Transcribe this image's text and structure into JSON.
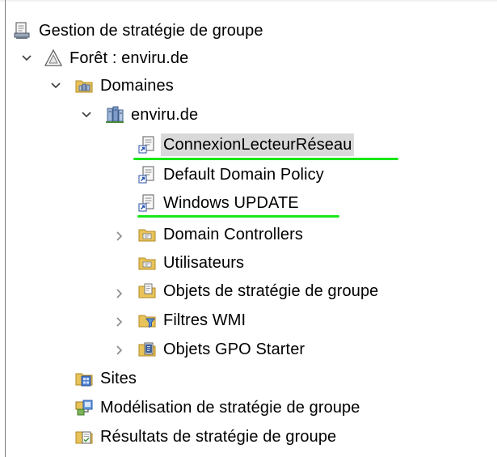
{
  "tree": {
    "root": {
      "label": "Gestion de stratégie de groupe",
      "icon": "gpmc-console-icon"
    },
    "forest": {
      "label": "Forêt : enviru.de",
      "icon": "forest-icon",
      "expanded": true
    },
    "domains": {
      "label": "Domaines",
      "icon": "domains-folder-icon",
      "expanded": true
    },
    "domain": {
      "label": "enviru.de",
      "icon": "domain-icon",
      "expanded": true
    },
    "gpo_links": [
      {
        "label": "ConnexionLecteurRéseau",
        "icon": "gpo-link-icon",
        "selected": true,
        "underlined": true
      },
      {
        "label": "Default Domain Policy",
        "icon": "gpo-link-icon",
        "selected": false,
        "underlined": false
      },
      {
        "label": "Windows UPDATE",
        "icon": "gpo-link-icon",
        "selected": false,
        "underlined": true
      }
    ],
    "containers": [
      {
        "label": "Domain Controllers",
        "icon": "ou-folder-icon",
        "expandable": true
      },
      {
        "label": "Utilisateurs",
        "icon": "ou-folder-icon",
        "expandable": false
      },
      {
        "label": "Objets de stratégie de groupe",
        "icon": "gpo-container-icon",
        "expandable": true
      },
      {
        "label": "Filtres WMI",
        "icon": "wmi-filter-icon",
        "expandable": true
      },
      {
        "label": "Objets GPO Starter",
        "icon": "starter-gpo-icon",
        "expandable": true
      }
    ],
    "sites": {
      "label": "Sites",
      "icon": "sites-icon"
    },
    "modeling": {
      "label": "Modélisation de stratégie de groupe",
      "icon": "modeling-icon"
    },
    "results": {
      "label": "Résultats de stratégie de groupe",
      "icon": "results-icon"
    }
  },
  "colors": {
    "highlight_underline": "#18e818",
    "selection_background": "#d9d9d9",
    "folder_yellow": "#e8c35a",
    "chevron": "#7a7a7a"
  }
}
